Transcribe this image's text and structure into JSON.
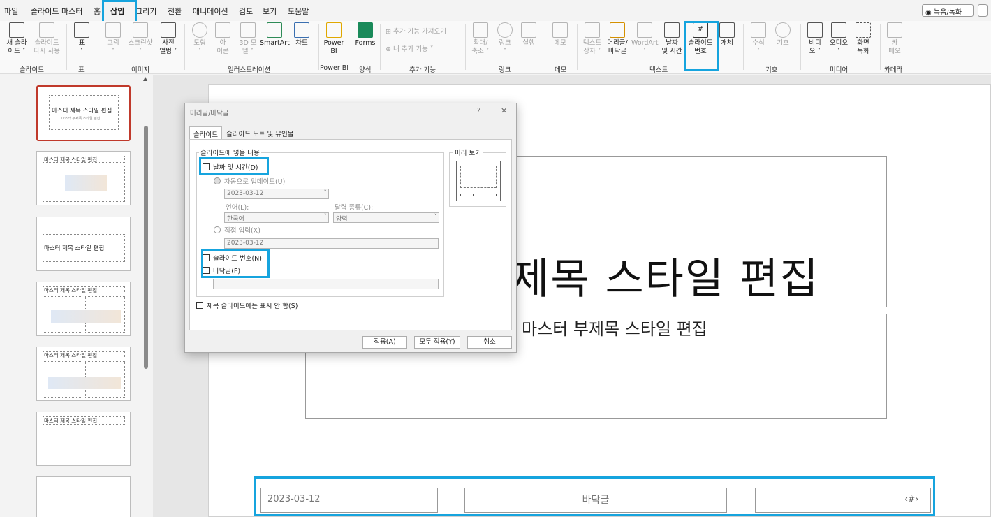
{
  "menubar": {
    "items": [
      "파일",
      "슬라이드 마스터",
      "홈",
      "삽입",
      "그리기",
      "전환",
      "애니메이션",
      "검토",
      "보기",
      "도움말"
    ],
    "record_button": "녹음/녹화"
  },
  "ribbon": {
    "buttons": {
      "new_slide": "새 슬라\n이드 ˅",
      "reuse_slides": "슬라이드\n다시 사용",
      "table": "표\n˅",
      "picture": "그림\n˅",
      "screenshot": "스크린샷\n˅",
      "photo_album": "사진\n앨범 ˅",
      "shapes": "도형\n˅",
      "icons": "아\n이콘",
      "models_3d": "3D 모\n델 ˅",
      "smartart": "SmartArt",
      "chart": "차트",
      "power_bi": "Power\nBI",
      "forms": "Forms",
      "get_addins": "추가 기능 가져오기",
      "my_addins": "내 추가 기능 ˅",
      "zoom": "확대/\n축소 ˅",
      "link": "링크\n˅",
      "action": "실행",
      "comment": "메모",
      "textbox": "텍스트\n상자 ˅",
      "header_footer": "머리글/\n바닥글",
      "wordart": "WordArt\n˅",
      "date_time": "날짜\n및 시간",
      "slide_number": "슬라이드\n번호",
      "object": "개체",
      "equation": "수식\n˅",
      "symbol": "기호",
      "video": "비디\n오 ˅",
      "audio": "오디오\n˅",
      "screen_recording": "화면\n녹화",
      "cameo": "카\n메오"
    },
    "groups": [
      "슬라이드",
      "표",
      "이미지",
      "일러스트레이션",
      "Power BI",
      "양식",
      "추가 기능",
      "링크",
      "메모",
      "텍스트",
      "기호",
      "미디어",
      "카메라"
    ]
  },
  "thumbnails": [
    {
      "title": "마스터 제목 스타일 편집",
      "sub": "마스터 부제목 스타일 편집"
    },
    {
      "title": "마스터 제목 스타일 편집"
    },
    {
      "title": "마스터 제목 스타일 편집"
    },
    {
      "title": "마스터 제목 스타일 편집"
    },
    {
      "title": "마스터 제목 스타일 편집"
    },
    {
      "title": "마스터 제목 스타일 편집"
    },
    {
      "title": ""
    }
  ],
  "slide": {
    "title": "제목 스타일 편집",
    "subtitle": "마스터 부제목 스타일 편집",
    "footer_date": "2023-03-12",
    "footer_text": "바닥글",
    "footer_number": "‹#›"
  },
  "dialog": {
    "title": "머리글/바닥글",
    "help": "?",
    "close": "✕",
    "tabs": [
      "슬라이드",
      "슬라이드 노트 및 유인물"
    ],
    "group_label": "슬라이드에 넣을 내용",
    "preview_label": "미리 보기",
    "date_time": "날짜 및 시간(D)",
    "auto_update": "자동으로 업데이트(U)",
    "date_value": "2023-03-12",
    "language_label": "언어(L):",
    "language_value": "한국어",
    "calendar_label": "달력 종류(C):",
    "calendar_value": "양력",
    "fixed": "직접 입력(X)",
    "fixed_value": "2023-03-12",
    "slide_number": "슬라이드 번호(N)",
    "footer": "바닥글(F)",
    "dont_show": "제목 슬라이드에는 표시 안 함(S)",
    "apply": "적용(A)",
    "apply_all": "모두 적용(Y)",
    "cancel": "취소"
  },
  "colors": {
    "highlight": "#16a4de",
    "selected_thumb": "#c0392b"
  }
}
